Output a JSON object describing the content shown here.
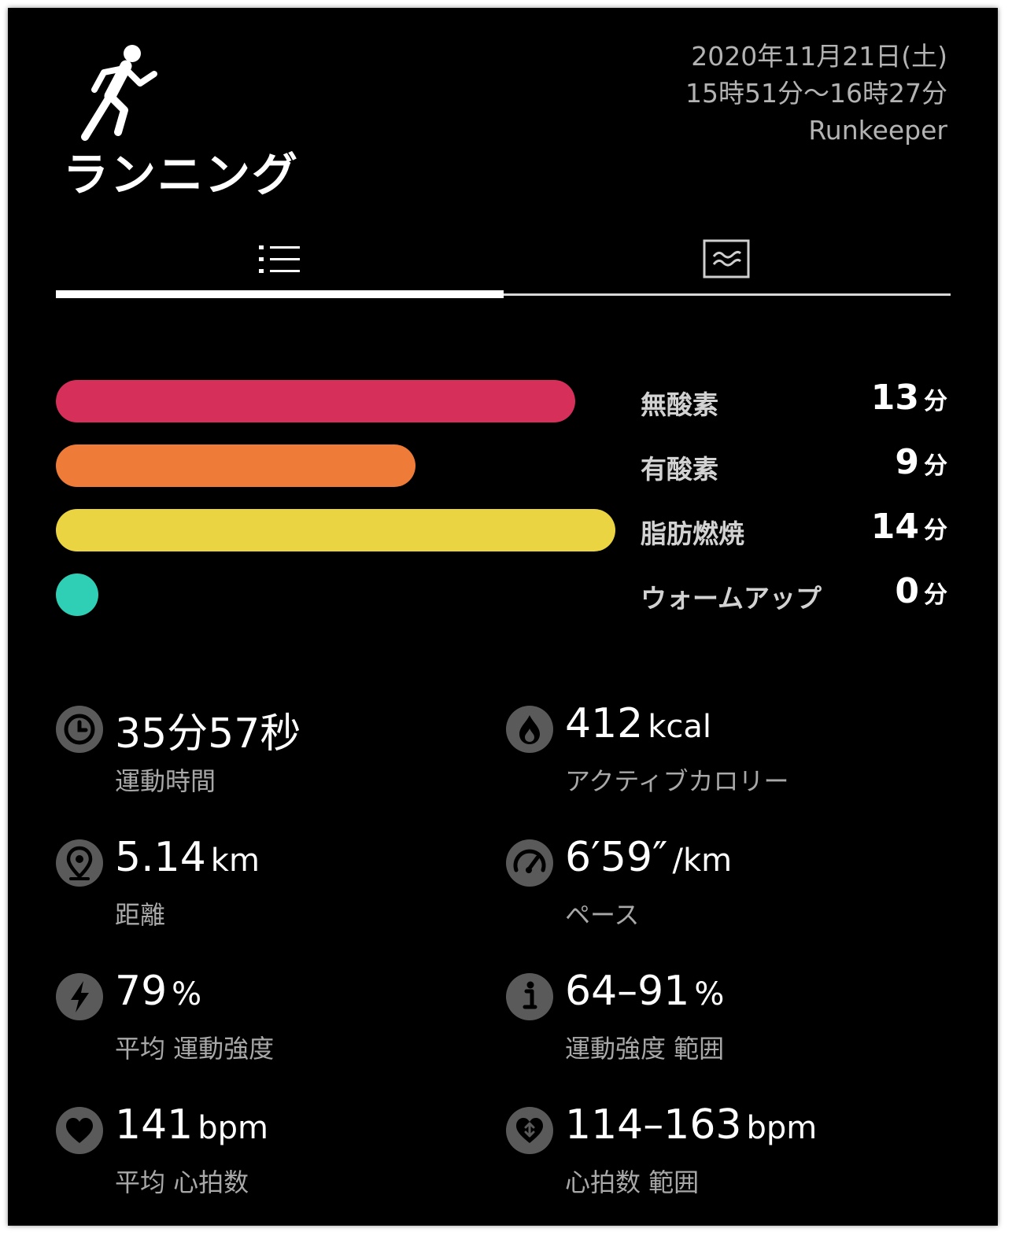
{
  "header": {
    "title": "ランニング",
    "date": "2020年11月21日(土)",
    "time_range": "15時51分～16時27分",
    "source": "Runkeeper"
  },
  "tabs": [
    {
      "name": "list-tab",
      "icon": "list-icon",
      "selected": true
    },
    {
      "name": "graph-tab",
      "icon": "graph-icon",
      "selected": false
    }
  ],
  "zones": [
    {
      "label": "無酸素",
      "value": "13",
      "unit": "分",
      "minutes": 13,
      "color": "#d6305a"
    },
    {
      "label": "有酸素",
      "value": "9",
      "unit": "分",
      "minutes": 9,
      "color": "#ee7c38"
    },
    {
      "label": "脂肪燃焼",
      "value": "14",
      "unit": "分",
      "minutes": 14,
      "color": "#ead442"
    },
    {
      "label": "ウォームアップ",
      "value": "0",
      "unit": "分",
      "minutes": 0,
      "color": "#2ecfb4"
    }
  ],
  "stats": {
    "duration": {
      "value": "35分57秒",
      "unit": "",
      "label": "運動時間",
      "icon": "clock-icon"
    },
    "calories": {
      "value": "412",
      "unit": "kcal",
      "label": "アクティブカロリー",
      "icon": "flame-icon"
    },
    "distance": {
      "value": "5.14",
      "unit": "km",
      "label": "距離",
      "icon": "location-pin-icon"
    },
    "pace": {
      "value": "6′59″",
      "unit": "/km",
      "label": "ペース",
      "icon": "speedometer-icon"
    },
    "avg_intensity": {
      "value": "79",
      "unit": "%",
      "label": "平均 運動強度",
      "icon": "lightning-icon"
    },
    "intensity_range": {
      "value": "64–91",
      "unit": "%",
      "label": "運動強度 範囲",
      "icon": "info-icon"
    },
    "avg_heart_rate": {
      "value": "141",
      "unit": "bpm",
      "label": "平均 心拍数",
      "icon": "heart-icon"
    },
    "heart_rate_range": {
      "value": "114–163",
      "unit": "bpm",
      "label": "心拍数 範囲",
      "icon": "heart-range-icon"
    }
  }
}
